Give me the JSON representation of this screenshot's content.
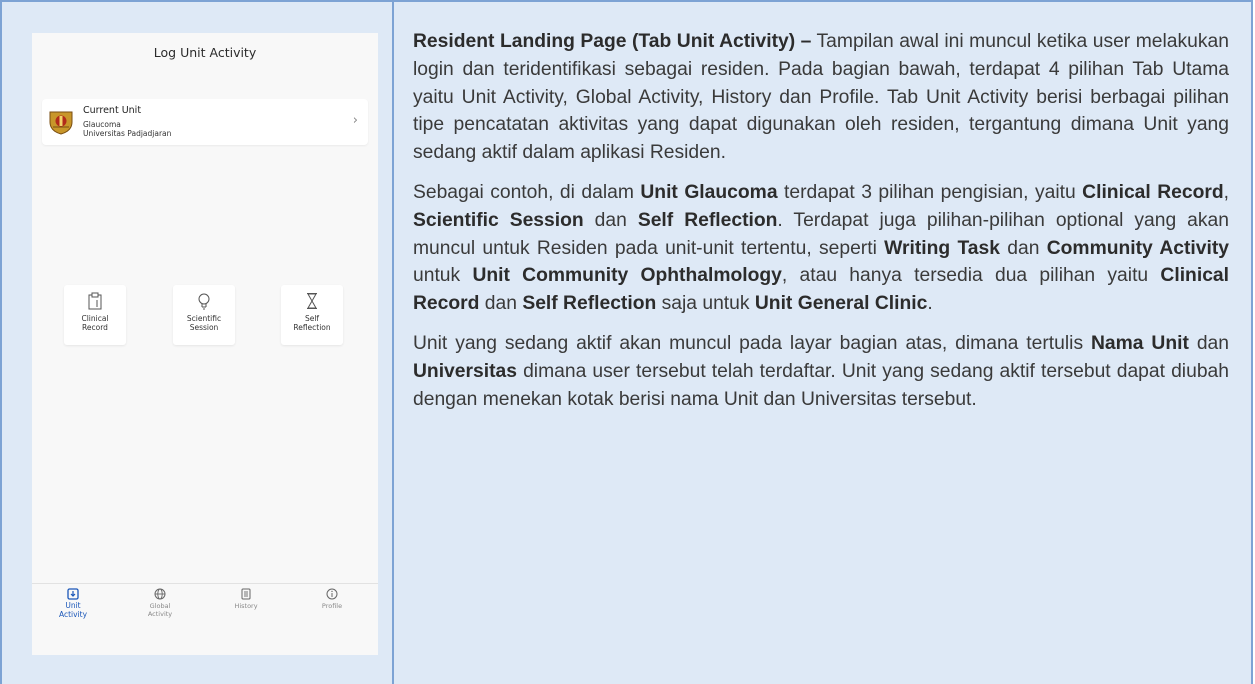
{
  "phone": {
    "title": "Log Unit Activity",
    "current_unit": {
      "label": "Current Unit",
      "unit_name": "Glaucoma",
      "university": "Universitas Padjadjaran",
      "chevron": "›"
    },
    "tiles": [
      {
        "icon": "clipboard-icon",
        "line1": "Clinical",
        "line2": "Record"
      },
      {
        "icon": "lightbulb-icon",
        "line1": "Scientific",
        "line2": "Session"
      },
      {
        "icon": "hourglass-icon",
        "line1": "Self",
        "line2": "Reflection"
      }
    ],
    "nav": [
      {
        "icon": "unit-activity-icon",
        "line1": "Unit",
        "line2": "Activity",
        "active": true
      },
      {
        "icon": "globe-icon",
        "line1": "Global",
        "line2": "Activity",
        "active": false
      },
      {
        "icon": "history-icon",
        "line1": "History",
        "line2": "",
        "active": false
      },
      {
        "icon": "info-icon",
        "line1": "Profile",
        "line2": "",
        "active": false
      }
    ],
    "colors": {
      "accent": "#1a56b8",
      "background": "#f8f8f8"
    }
  },
  "description": {
    "p1": {
      "title": "Resident Landing Page (Tab Unit Activity) –",
      "text": " Tampilan awal ini muncul ketika user melakukan login dan teridentifikasi sebagai residen. Pada bagian bawah, terdapat 4 pilihan Tab Utama yaitu Unit Activity, Global Activity, History dan Profile. Tab Unit Activity berisi berbagai pilihan tipe pencatatan aktivitas yang dapat digunakan oleh residen, tergantung dimana Unit yang sedang aktif dalam aplikasi Residen."
    },
    "p2": {
      "t1": "Sebagai contoh, di dalam ",
      "b1": "Unit Glaucoma",
      "t2": " terdapat 3 pilihan pengisian, yaitu ",
      "b2": "Clinical Record",
      "t3": ", ",
      "b3": "Scientific Session",
      "t4": " dan ",
      "b4": "Self Reflection",
      "t5": ". Terdapat juga pilihan-pilihan optional yang akan muncul untuk Residen pada unit-unit tertentu, seperti ",
      "b5": "Writing Task",
      "t6": " dan ",
      "b6": "Community Activity",
      "t7": " untuk ",
      "b7": "Unit Community Ophthalmology",
      "t8": ", atau hanya tersedia dua pilihan yaitu ",
      "b8": "Clinical Record",
      "t9": " dan ",
      "b9": "Self Reflection",
      "t10": " saja untuk ",
      "b10": "Unit General Clinic",
      "t11": "."
    },
    "p3": {
      "t1": "Unit yang sedang aktif akan muncul pada layar bagian atas, dimana tertulis ",
      "b1": "Nama Unit",
      "t2": " dan ",
      "b2": "Universitas",
      "t3": " dimana user tersebut telah terdaftar. Unit yang sedang aktif tersebut dapat diubah dengan menekan kotak berisi nama Unit dan Universitas tersebut."
    }
  }
}
